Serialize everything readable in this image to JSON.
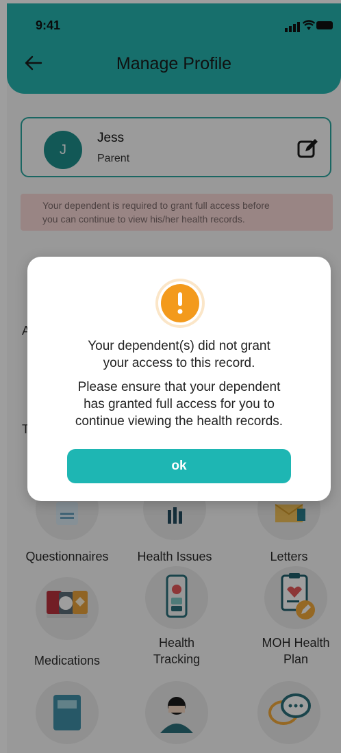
{
  "status_bar": {
    "time": "9:41"
  },
  "header": {
    "title": "Manage Profile"
  },
  "profile": {
    "initial": "J",
    "name": "Jess",
    "role": "Parent"
  },
  "notice": {
    "line1": "Your dependent is required to grant full access before",
    "line2": "you can continue to view his/her health records."
  },
  "background_labels": {
    "section_a": "A",
    "section_t": "T"
  },
  "tiles": [
    {
      "label": "Questionnaires"
    },
    {
      "label": "Health Issues"
    },
    {
      "label": "Letters"
    },
    {
      "label": "Medications"
    },
    {
      "label_line1": "Health",
      "label_line2": "Tracking"
    },
    {
      "label_line1": "MOH Health",
      "label_line2": "Plan"
    }
  ],
  "modal": {
    "line1": "Your dependent(s) did not grant",
    "line2": "your access to this record.",
    "line3": "Please ensure that your dependent",
    "line4": "has granted full access for you to",
    "line5": "continue viewing the health records.",
    "button": "ok"
  },
  "colors": {
    "accent": "#1eb6b3",
    "header": "#26b3ae",
    "warning": "#f39a1c",
    "notice": "#f7d7d6"
  }
}
